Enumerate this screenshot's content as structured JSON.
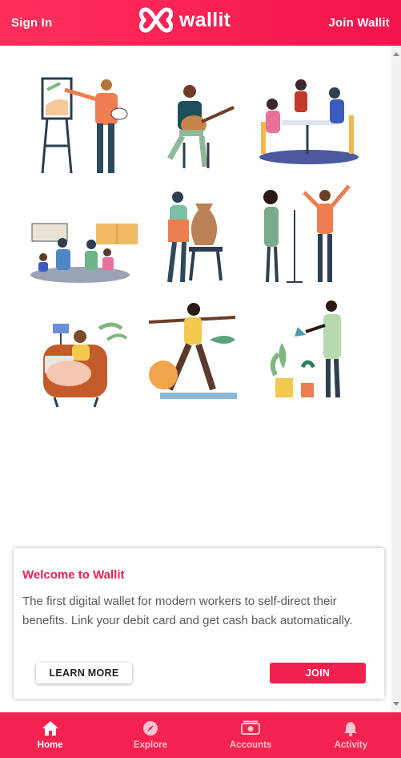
{
  "header": {
    "sign_in": "Sign In",
    "brand": "wallit",
    "join": "Join Wallit"
  },
  "illustrations": [
    {
      "name": "painter",
      "icon": "painter-illustration"
    },
    {
      "name": "guitarist",
      "icon": "guitarist-illustration"
    },
    {
      "name": "restaurant-dinner",
      "icon": "dining-illustration"
    },
    {
      "name": "family-cooking",
      "icon": "cooking-illustration"
    },
    {
      "name": "pottery",
      "icon": "pottery-illustration"
    },
    {
      "name": "singers",
      "icon": "singers-illustration"
    },
    {
      "name": "reading-armchair",
      "icon": "reading-illustration"
    },
    {
      "name": "yoga",
      "icon": "yoga-illustration"
    },
    {
      "name": "gardening",
      "icon": "gardening-illustration"
    }
  ],
  "welcome": {
    "title": "Welcome to Wallit",
    "body": "The first digital wallet for modern workers to self-direct their benefits. Link your debit card and get cash back automatically.",
    "learn_more": "LEARN MORE",
    "join": "JOIN"
  },
  "nav": {
    "home": "Home",
    "explore": "Explore",
    "accounts": "Accounts",
    "activity": "Activity"
  },
  "colors": {
    "brand": "#f2204f",
    "nav_inactive": "#ffc2cf"
  }
}
